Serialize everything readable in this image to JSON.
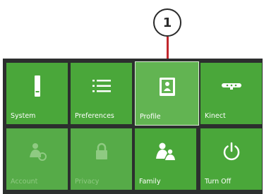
{
  "callout": {
    "number": "1"
  },
  "menu": {
    "tiles": [
      {
        "label": "System",
        "icon": "console-icon",
        "state": "normal"
      },
      {
        "label": "Preferences",
        "icon": "list-icon",
        "state": "normal"
      },
      {
        "label": "Profile",
        "icon": "profile-card-icon",
        "state": "selected"
      },
      {
        "label": "Kinect",
        "icon": "kinect-sensor-icon",
        "state": "normal"
      },
      {
        "label": "Account",
        "icon": "account-icon",
        "state": "disabled"
      },
      {
        "label": "Privacy",
        "icon": "lock-icon",
        "state": "disabled"
      },
      {
        "label": "Family",
        "icon": "family-icon",
        "state": "normal"
      },
      {
        "label": "Turn Off",
        "icon": "power-icon",
        "state": "normal"
      }
    ]
  },
  "colors": {
    "tile": "#4aa73a",
    "panel": "#2c2f2e",
    "callout_line": "#c1272d"
  }
}
